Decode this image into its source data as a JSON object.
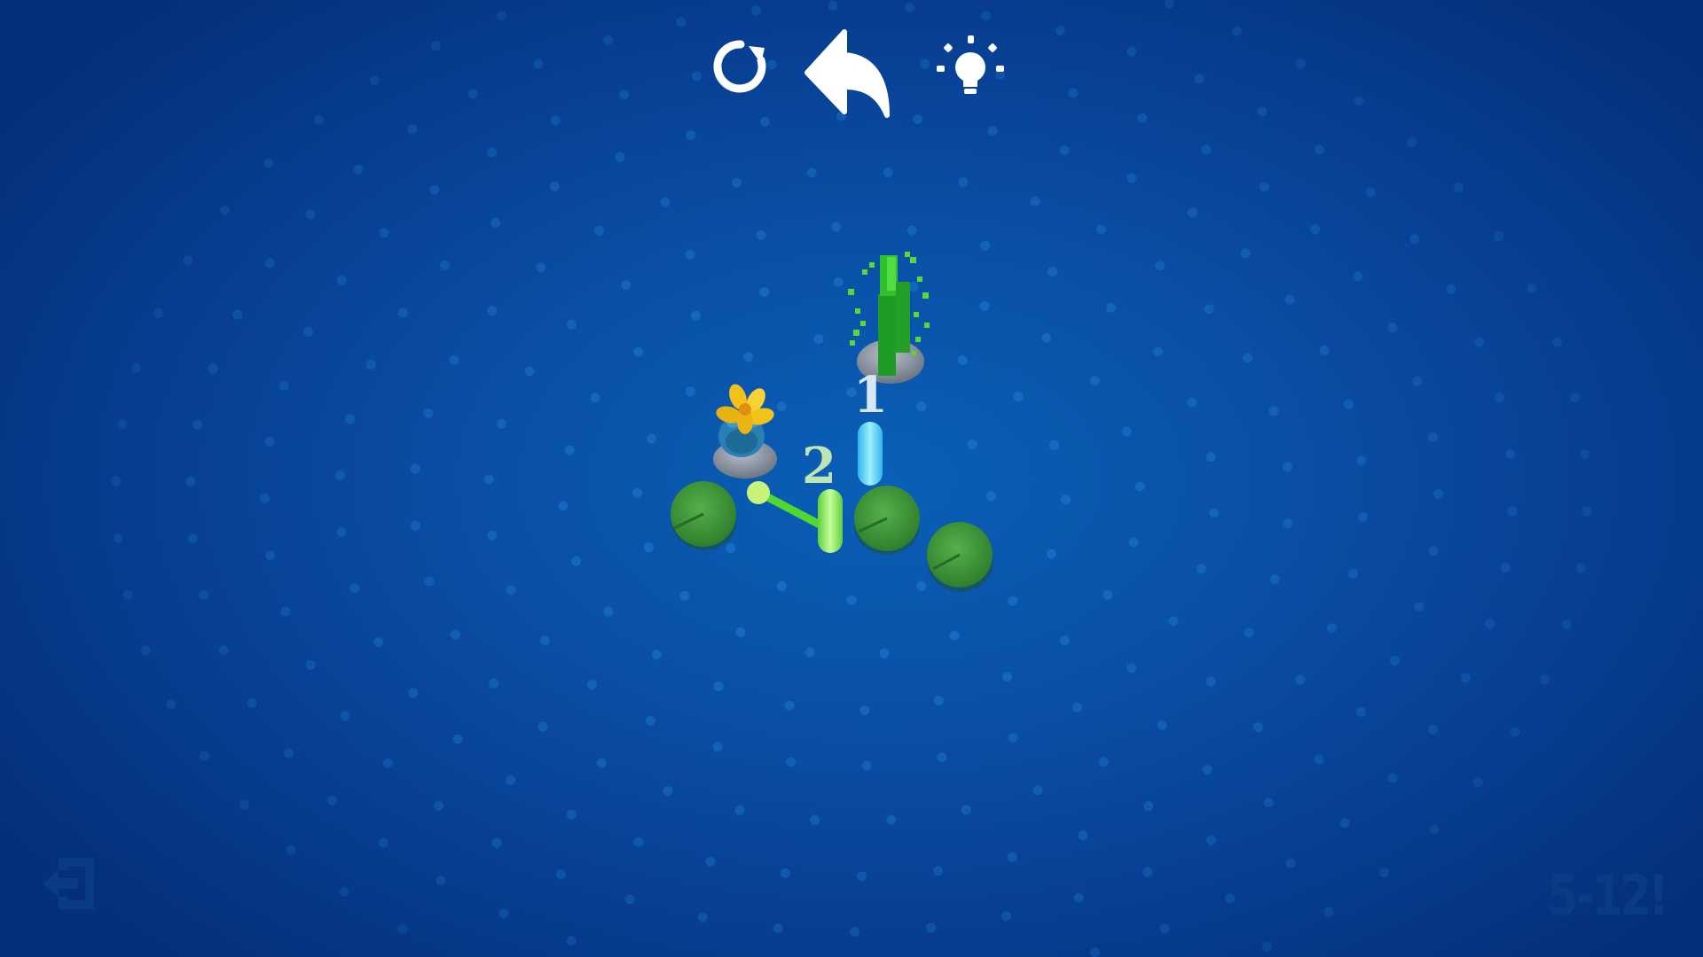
{
  "toolbar": {
    "restart_icon": "restart-icon",
    "undo_icon": "undo-arrow-icon",
    "hint_icon": "lightbulb-icon"
  },
  "exit_icon": "exit-door-icon",
  "level": {
    "label": "5-12!"
  },
  "board": {
    "move_numbers": [
      "1",
      "2"
    ],
    "pieces": [
      "frog-with-flower",
      "reed-goal",
      "stone",
      "lily-pad",
      "cyan-marker",
      "green-marker"
    ]
  },
  "colors": {
    "water": "#0a4fa6",
    "water_dots": "#1a73c9",
    "lily_pad": "#3f9b3a",
    "reeds": "#2fbf2f",
    "stone": "#8c96a3",
    "flower": "#f3c21a",
    "frog": "#2a7fb5",
    "cyan_marker": "#5fd6ff",
    "green_marker": "#7fe35a",
    "level_text": "#0b3b85"
  }
}
